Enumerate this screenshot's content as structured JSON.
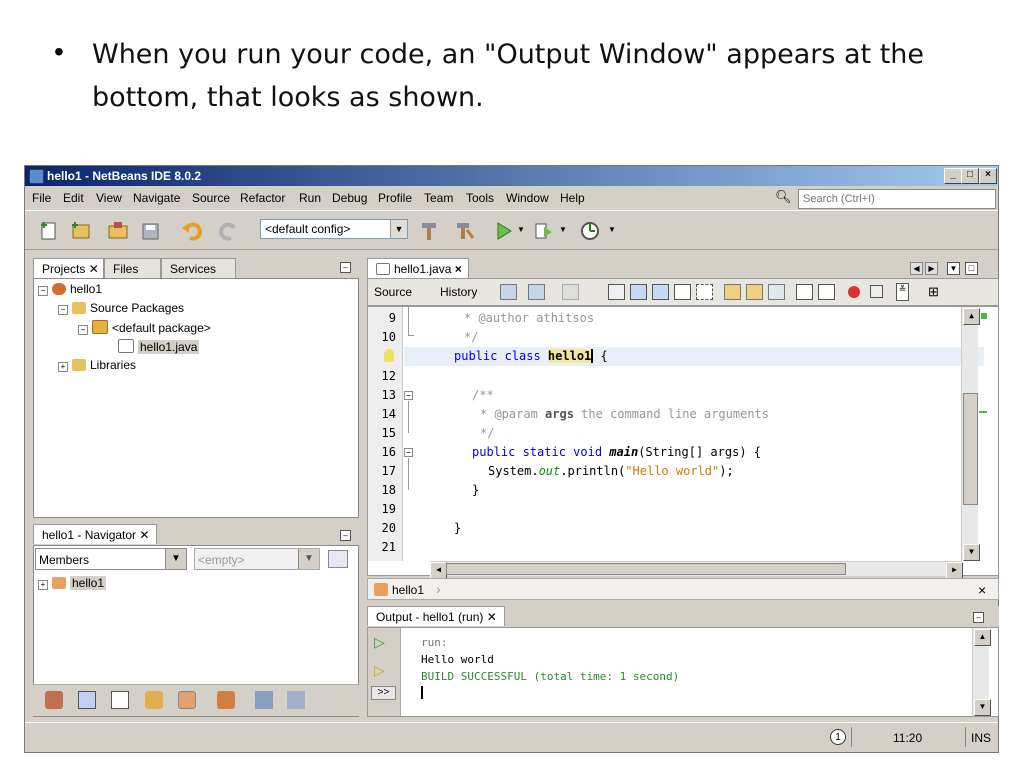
{
  "slide": {
    "bullet": "•",
    "text": "When you run your code, an \"Output Window\" appears at the bottom, that looks as shown."
  },
  "window": {
    "title": "hello1 - NetBeans IDE 8.0.2",
    "controls": {
      "minimize": "_",
      "maximize": "□",
      "close": "×"
    }
  },
  "menu": [
    "File",
    "Edit",
    "View",
    "Navigate",
    "Source",
    "Refactor",
    "Run",
    "Debug",
    "Profile",
    "Team",
    "Tools",
    "Window",
    "Help"
  ],
  "search": {
    "placeholder": "Search (Ctrl+I)"
  },
  "toolbar": {
    "config": "<default config>"
  },
  "projects": {
    "tabs": [
      "Projects",
      "Files",
      "Services"
    ],
    "tree": {
      "project": "hello1",
      "source_packages": "Source Packages",
      "default_package": "<default package>",
      "file": "hello1.java",
      "libraries": "Libraries"
    }
  },
  "navigator": {
    "title": "hello1 - Navigator",
    "members": "Members",
    "filter": "<empty>",
    "class_node": "hello1"
  },
  "editor": {
    "file_tab": "hello1.java",
    "source_tab": "Source",
    "history_tab": "History",
    "breadcrumb": "hello1",
    "lines": [
      "9",
      "10",
      "",
      "12",
      "13",
      "14",
      "15",
      "16",
      "17",
      "18",
      "19",
      "20",
      "21"
    ],
    "code": {
      "l9": "* @author athitsos",
      "l10": "*/",
      "l11_kw": "public class ",
      "l11_name": "hello1",
      "l11_brace": " {",
      "l13": "/**",
      "l14_a": "* @param ",
      "l14_b": "args",
      "l14_c": " the command line arguments",
      "l15": "*/",
      "l16_kw": "public static void ",
      "l16_name": "main",
      "l16_rest": "(String[] args) {",
      "l17_a": "System.",
      "l17_b": "out",
      "l17_c": ".println(",
      "l17_d": "\"Hello world\"",
      "l17_e": ");",
      "l18": "}",
      "l20": "}"
    }
  },
  "output": {
    "title": "Output - hello1 (run)",
    "lines": [
      "run:",
      "Hello world",
      "BUILD SUCCESSFUL (total time: 1 second)"
    ],
    "more": ">>"
  },
  "statusbar": {
    "notifications": "1",
    "position": "11:20",
    "mode": "INS"
  }
}
